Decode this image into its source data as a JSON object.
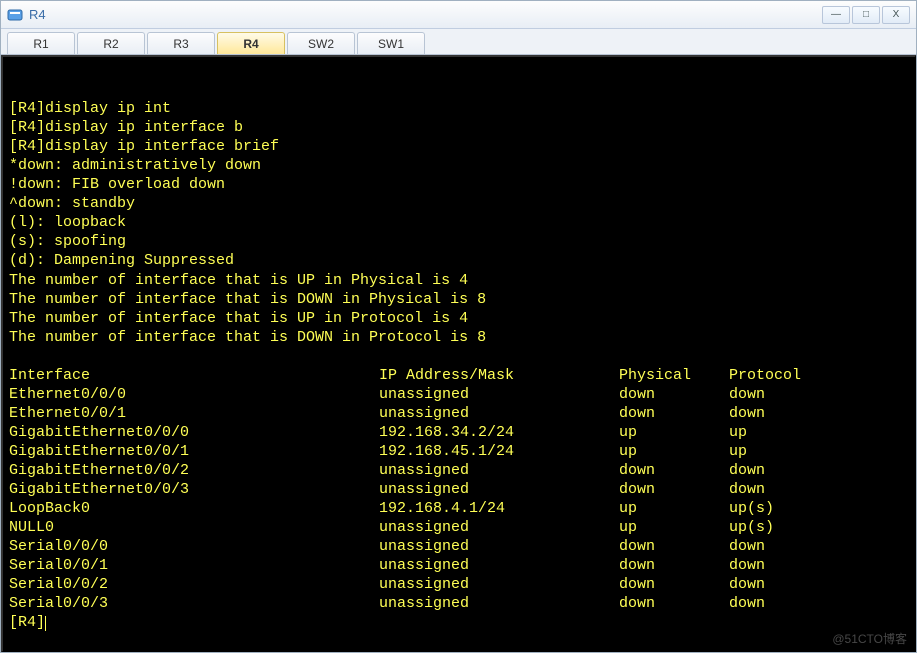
{
  "window": {
    "title": "R4",
    "controls": {
      "min": "—",
      "max": "□",
      "close": "X"
    }
  },
  "tabs": [
    {
      "label": "R1",
      "active": false
    },
    {
      "label": "R2",
      "active": false
    },
    {
      "label": "R3",
      "active": false
    },
    {
      "label": "R4",
      "active": true
    },
    {
      "label": "SW2",
      "active": false
    },
    {
      "label": "SW1",
      "active": false
    }
  ],
  "terminal": {
    "commands": [
      "[R4]display ip int",
      "[R4]display ip interface b",
      "[R4]display ip interface brief"
    ],
    "notes": [
      "*down: administratively down",
      "!down: FIB overload down",
      "^down: standby",
      "(l): loopback",
      "(s): spoofing",
      "(d): Dampening Suppressed",
      "The number of interface that is UP in Physical is 4",
      "The number of interface that is DOWN in Physical is 8",
      "The number of interface that is UP in Protocol is 4",
      "The number of interface that is DOWN in Protocol is 8"
    ],
    "header": {
      "c1": "Interface",
      "c2": "IP Address/Mask",
      "c3": "Physical",
      "c4": "Protocol"
    },
    "rows": [
      {
        "c1": "Ethernet0/0/0",
        "c2": "unassigned",
        "c3": "down",
        "c4": "down"
      },
      {
        "c1": "Ethernet0/0/1",
        "c2": "unassigned",
        "c3": "down",
        "c4": "down"
      },
      {
        "c1": "GigabitEthernet0/0/0",
        "c2": "192.168.34.2/24",
        "c3": "up",
        "c4": "up"
      },
      {
        "c1": "GigabitEthernet0/0/1",
        "c2": "192.168.45.1/24",
        "c3": "up",
        "c4": "up"
      },
      {
        "c1": "GigabitEthernet0/0/2",
        "c2": "unassigned",
        "c3": "down",
        "c4": "down"
      },
      {
        "c1": "GigabitEthernet0/0/3",
        "c2": "unassigned",
        "c3": "down",
        "c4": "down"
      },
      {
        "c1": "LoopBack0",
        "c2": "192.168.4.1/24",
        "c3": "up",
        "c4": "up(s)"
      },
      {
        "c1": "NULL0",
        "c2": "unassigned",
        "c3": "up",
        "c4": "up(s)"
      },
      {
        "c1": "Serial0/0/0",
        "c2": "unassigned",
        "c3": "down",
        "c4": "down"
      },
      {
        "c1": "Serial0/0/1",
        "c2": "unassigned",
        "c3": "down",
        "c4": "down"
      },
      {
        "c1": "Serial0/0/2",
        "c2": "unassigned",
        "c3": "down",
        "c4": "down"
      },
      {
        "c1": "Serial0/0/3",
        "c2": "unassigned",
        "c3": "down",
        "c4": "down"
      }
    ],
    "prompt": "[R4]"
  },
  "watermark": "@51CTO博客"
}
